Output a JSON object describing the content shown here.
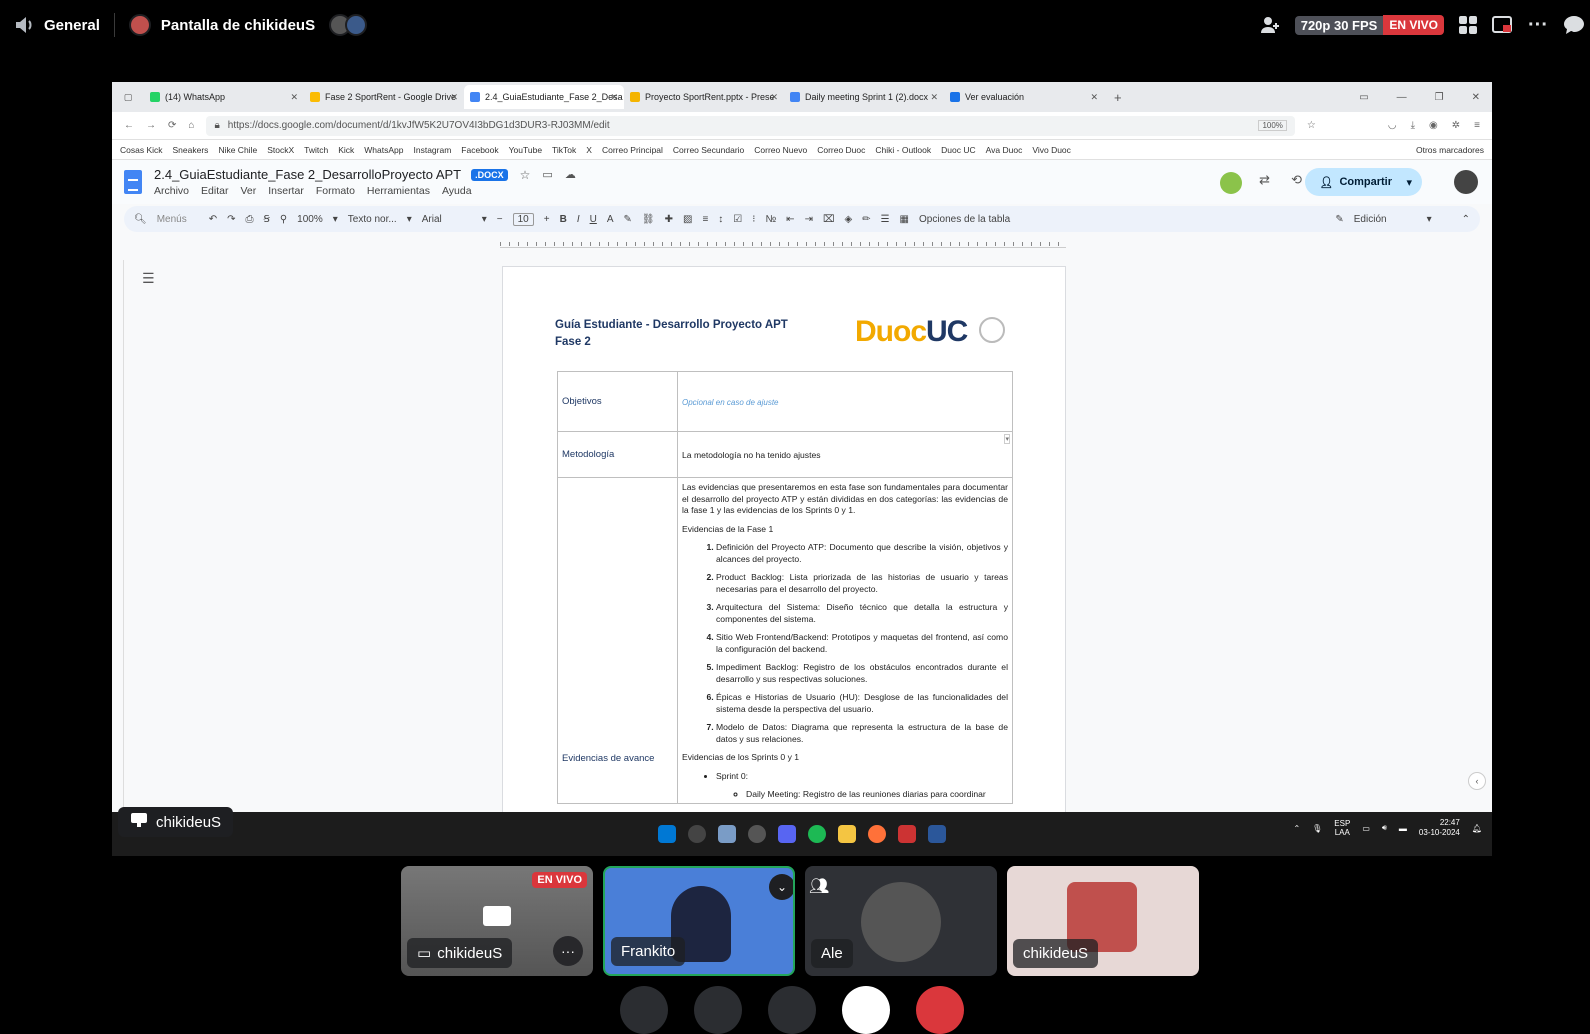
{
  "topbar": {
    "channel": "General",
    "stream_title": "Pantalla de chikideuS",
    "quality": "720p 30 FPS",
    "live": "EN VIVO"
  },
  "browser": {
    "tabs": [
      {
        "label": "(14) WhatsApp",
        "color": "#25d366"
      },
      {
        "label": "Fase 2 SportRent - Google Drive",
        "color": "#fbbc04"
      },
      {
        "label": "2.4_GuiaEstudiante_Fase 2_Desa",
        "color": "#4285f4"
      },
      {
        "label": "Proyecto SportRent.pptx - Prese",
        "color": "#f4b400"
      },
      {
        "label": "Daily meeting Sprint 1 (2).docx",
        "color": "#4285f4"
      },
      {
        "label": "Ver evaluación",
        "color": "#1a73e8"
      }
    ],
    "url": "https://docs.google.com/document/d/1kvJfW5K2U7OV4I3bDG1d3DUR3-RJ03MM/edit",
    "zoom": "100%",
    "bookmarks": [
      "Cosas Kick",
      "Sneakers",
      "Nike Chile",
      "StockX",
      "Twitch",
      "Kick",
      "WhatsApp",
      "Instagram",
      "Facebook",
      "YouTube",
      "TikTok",
      "X",
      "Correo Principal",
      "Correo Secundario",
      "Correo Nuevo",
      "Correo Duoc",
      "Chiki - Outlook",
      "Duoc UC",
      "Ava Duoc",
      "Vivo Duoc"
    ],
    "other_bookmarks": "Otros marcadores"
  },
  "docs": {
    "title": "2.4_GuiaEstudiante_Fase 2_DesarrolloProyecto APT",
    "badge": ".DOCX",
    "menus": [
      "Archivo",
      "Editar",
      "Ver",
      "Insertar",
      "Formato",
      "Herramientas",
      "Ayuda"
    ],
    "share": "Compartir",
    "toolbar": {
      "search": "Menús",
      "zoom": "100%",
      "style": "Texto nor...",
      "font": "Arial",
      "size": "10",
      "table_options": "Opciones de la tabla",
      "mode": "Edición"
    }
  },
  "page": {
    "heading_line1": "Guía Estudiante - Desarrollo Proyecto APT",
    "heading_line2": "Fase 2",
    "logo_a": "Duoc",
    "logo_b": "UC",
    "rows": {
      "objetivos_label": "Objetivos",
      "objetivos_hint": "Opcional en caso de ajuste",
      "metodologia_label": "Metodología",
      "metodologia_text": "La metodología no ha tenido ajustes",
      "evidencias_label": "Evidencias de avance",
      "intro": "Las evidencias que presentaremos en esta fase son fundamentales para documentar el desarrollo del proyecto ATP y están divididas en dos categorías: las evidencias de la fase 1 y las evidencias de los Sprints 0 y 1.",
      "fase1_heading": "Evidencias de la Fase 1",
      "fase1_items": [
        "Definición del Proyecto ATP: Documento que describe la visión, objetivos y alcances del proyecto.",
        "Product Backlog: Lista priorizada de las historias de usuario y tareas necesarias para el desarrollo del proyecto.",
        "Arquitectura del Sistema: Diseño técnico que detalla la estructura y componentes del sistema.",
        "Sitio Web Frontend/Backend: Prototipos y maquetas del frontend, así como la configuración del backend.",
        "Impediment Backlog: Registro de los obstáculos encontrados durante el desarrollo y sus respectivas soluciones.",
        "Épicas e Historias de Usuario (HU): Desglose de las funcionalidades del sistema desde la perspectiva del usuario.",
        "Modelo de Datos: Diagrama que representa la estructura de la base de datos y sus relaciones."
      ],
      "sprints_heading": "Evidencias de los Sprints 0 y 1",
      "sprint0": "Sprint 0:",
      "daily": "Daily Meeting: Registro de las reuniones diarias para coordinar"
    }
  },
  "screen_chip": "chikideuS",
  "taskbar": {
    "lang_top": "ESP",
    "lang_bottom": "LAA",
    "time": "22:47",
    "date": "03-10-2024"
  },
  "participants": [
    {
      "name": "chikideuS",
      "live": "EN VIVO"
    },
    {
      "name": "Frankito"
    },
    {
      "name": "Ale"
    },
    {
      "name": "chikideuS"
    }
  ]
}
